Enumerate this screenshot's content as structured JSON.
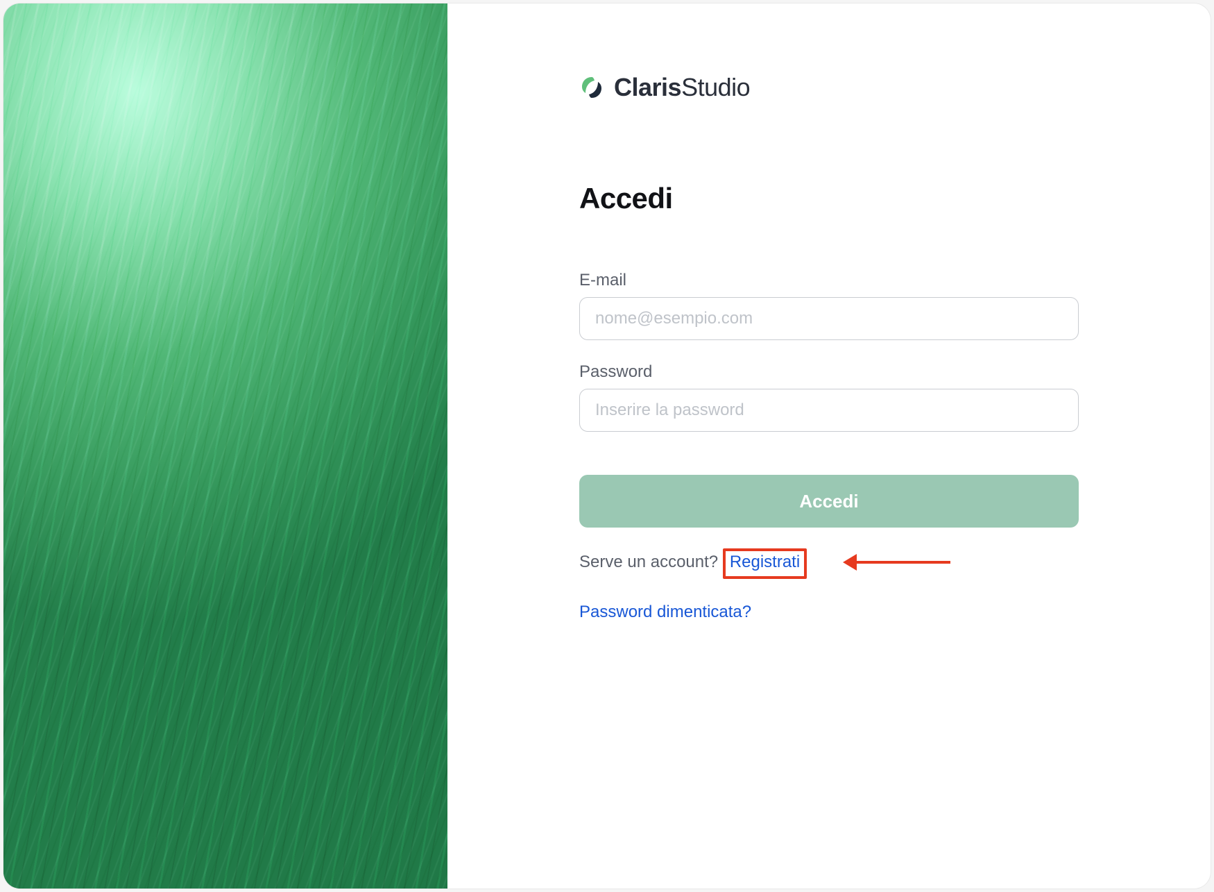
{
  "brand": {
    "name_bold": "Claris",
    "name_light": "Studio"
  },
  "heading": "Accedi",
  "fields": {
    "email": {
      "label": "E-mail",
      "placeholder": "nome@esempio.com",
      "value": ""
    },
    "password": {
      "label": "Password",
      "placeholder": "Inserire la password",
      "value": ""
    }
  },
  "buttons": {
    "login": "Accedi"
  },
  "signup": {
    "prompt": "Serve un account?",
    "link_text": "Registrati"
  },
  "forgot": {
    "link_text": "Password dimenticata?"
  },
  "annotation": {
    "highlight_target": "signup-link",
    "color": "#e63a1f"
  }
}
